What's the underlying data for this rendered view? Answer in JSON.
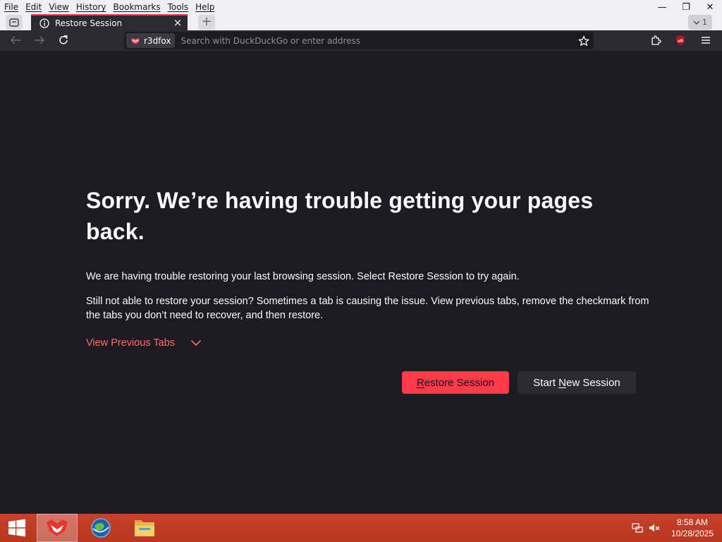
{
  "menubar": {
    "items": [
      {
        "label": "File"
      },
      {
        "label": "Edit"
      },
      {
        "label": "View"
      },
      {
        "label": "History"
      },
      {
        "label": "Bookmarks"
      },
      {
        "label": "Tools"
      },
      {
        "label": "Help"
      }
    ]
  },
  "window_controls": {
    "minimize": "—",
    "restore": "❐",
    "close": "✕"
  },
  "tabs": {
    "active_title": "Restore Session",
    "close_glyph": "×",
    "new_tab_glyph": "+",
    "overflow_count": "1"
  },
  "toolbar": {
    "identity_label": "r3dfox",
    "url_placeholder": "Search with DuckDuckGo or enter address",
    "url_value": ""
  },
  "page": {
    "title": "Sorry. We’re having trouble getting your pages back.",
    "para1": "We are having trouble restoring your last browsing session. Select Restore Session to try again.",
    "para2": "Still not able to restore your session? Sometimes a tab is causing the issue. View previous tabs, remove the checkmark from the tabs you don’t need to recover, and then restore.",
    "view_previous_tabs": "View Previous Tabs",
    "restore_button": {
      "pre": "",
      "accel": "R",
      "post": "estore Session"
    },
    "new_session_button": {
      "pre": "Start ",
      "accel": "N",
      "post": "ew Session"
    }
  },
  "taskbar": {
    "time": "8:58 AM",
    "date": "10/28/2025"
  },
  "colors": {
    "content_bg": "#1c1b22",
    "toolbar_bg": "#2b2a33",
    "accent_red": "#ff3b4a",
    "link_red": "#ff6a6f",
    "taskbar_red": "#c7402c"
  },
  "icons": {
    "tab_list": "tab-list-icon",
    "tab_info": "info-icon",
    "back": "back-arrow-icon",
    "forward": "forward-arrow-icon",
    "reload": "reload-icon",
    "star": "bookmark-star-icon",
    "extensions": "extensions-puzzle-icon",
    "ublock": "ublock-icon",
    "menu": "hamburger-menu-icon",
    "chevron": "chevron-down-icon",
    "start": "windows-logo-icon",
    "network": "network-icon",
    "volume": "volume-muted-icon"
  }
}
